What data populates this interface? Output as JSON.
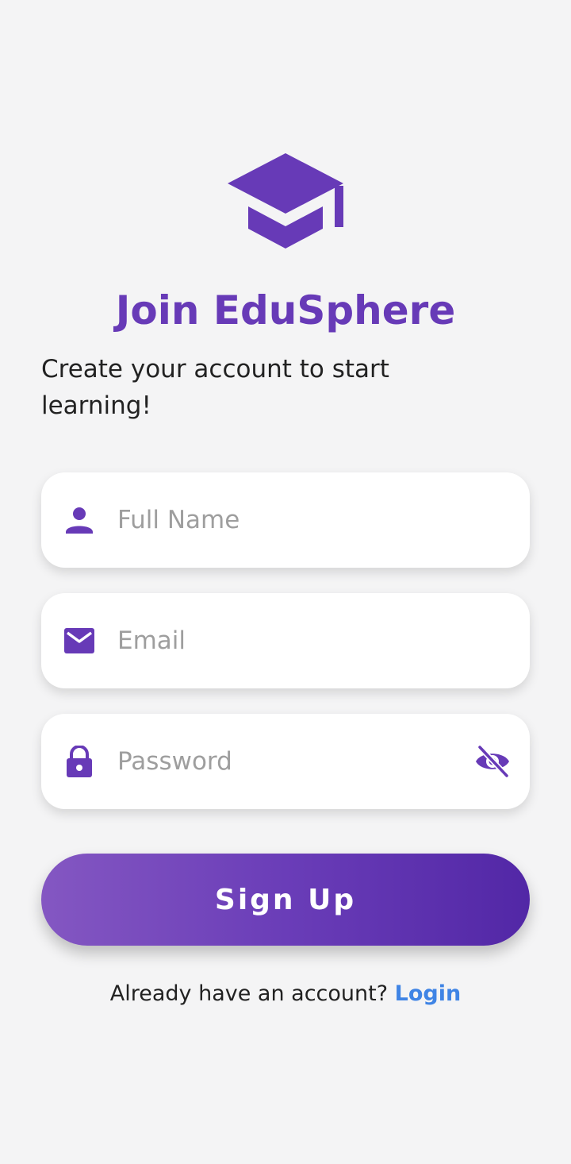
{
  "header": {
    "logo_icon": "graduation-cap-icon",
    "title": "Join EduSphere",
    "subtitle": "Create your account to start learning!"
  },
  "form": {
    "full_name": {
      "placeholder": "Full Name",
      "value": "",
      "icon": "person-icon"
    },
    "email": {
      "placeholder": "Email",
      "value": "",
      "icon": "mail-icon"
    },
    "password": {
      "placeholder": "Password",
      "value": "",
      "icon": "lock-icon",
      "toggle_icon": "eye-off-icon"
    },
    "submit_label": "Sign Up"
  },
  "footer": {
    "prompt": "Already have an account?",
    "link_label": "Login"
  },
  "colors": {
    "primary": "#673ab7",
    "background": "#f4f4f5",
    "link": "#3f84e5",
    "button_gradient_start": "#8457c2",
    "button_gradient_end": "#5227a6"
  }
}
